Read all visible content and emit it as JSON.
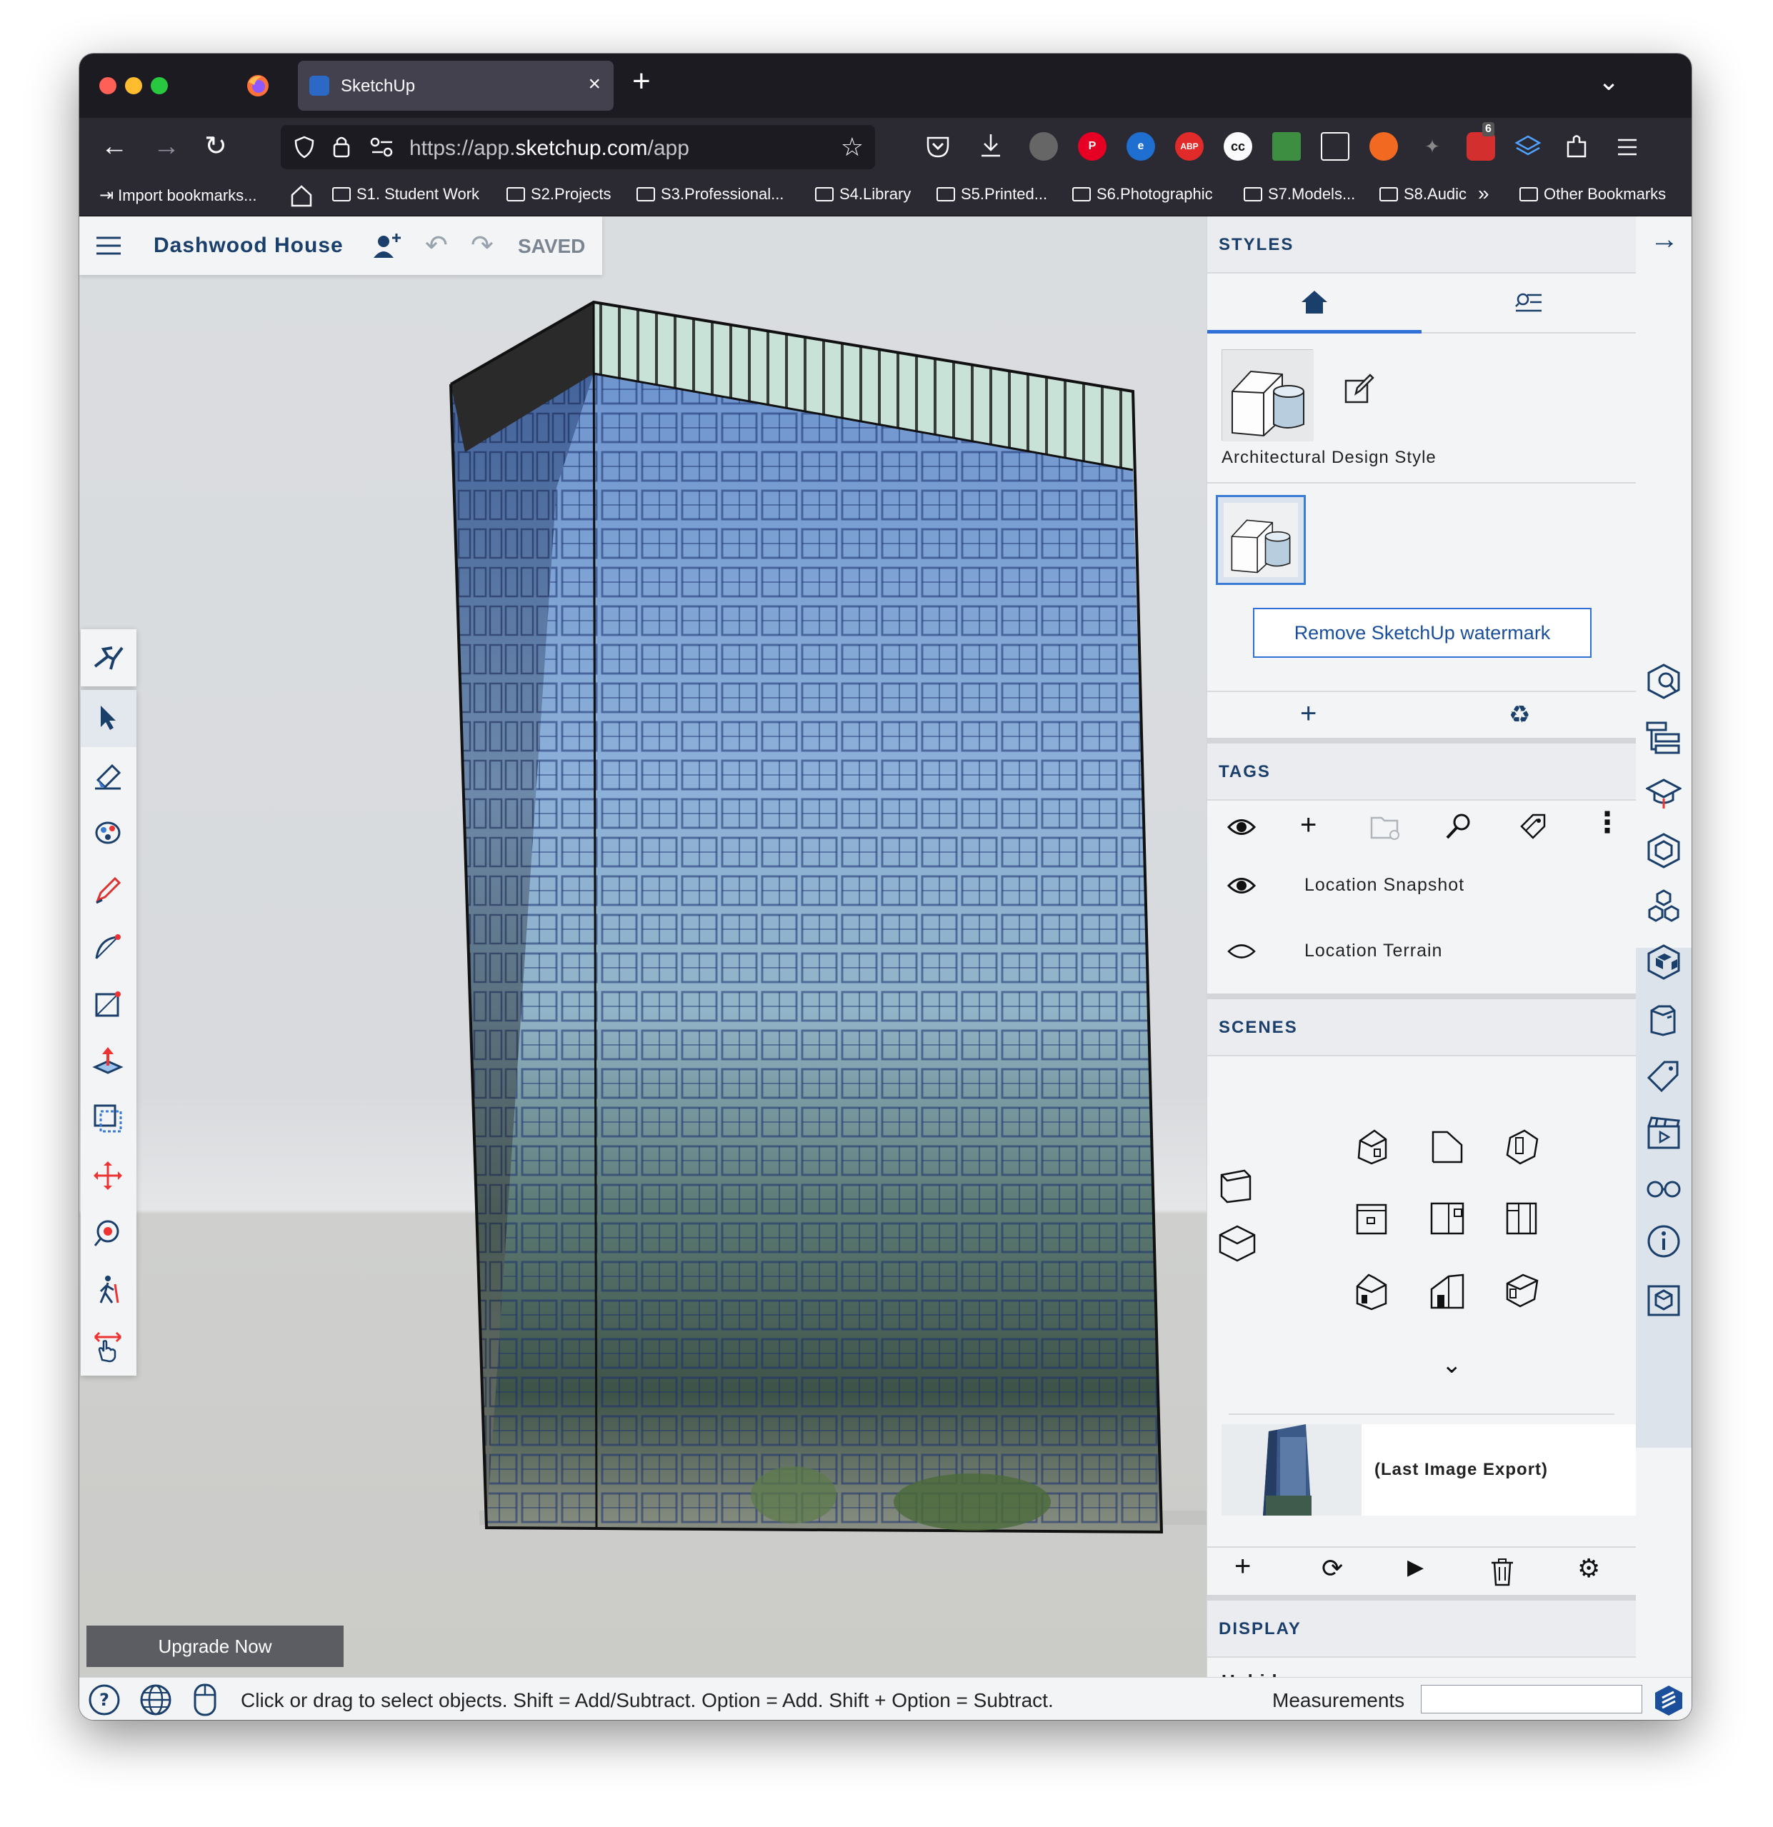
{
  "browser": {
    "tab_title": "SketchUp",
    "tab_close": "×",
    "new_tab": "+",
    "tab_list": "⌄",
    "url_prefix": "https://app.",
    "url_domain": "sketchup.com",
    "url_path": "/app",
    "ext_abp": "ABP",
    "ext_cc": "cc",
    "ext_badge": "6",
    "bookmarks": [
      "Import bookmarks...",
      "S1. Student Work",
      "S2.Projects",
      "S3.Professional...",
      "S4.Library",
      "S5.Printed...",
      "S6.Photographic",
      "S7.Models...",
      "S8.Audic",
      "Other Bookmarks"
    ]
  },
  "app": {
    "model_title": "Dashwood House",
    "save_status": "SAVED",
    "upgrade_label": "Upgrade Now"
  },
  "styles": {
    "header": "STYLES",
    "style_name": "Architectural Design Style",
    "watermark_button": "Remove SketchUp watermark"
  },
  "tags": {
    "header": "TAGS",
    "items": [
      {
        "name": "Location Snapshot"
      },
      {
        "name": "Location Terrain"
      }
    ]
  },
  "scenes": {
    "header": "SCENES",
    "scene_name": "(Last Image Export)"
  },
  "display": {
    "header": "DISPLAY",
    "unhide": "Unhide"
  },
  "status": {
    "hint": "Click or drag to select objects. Shift = Add/Subtract. Option = Add. Shift + Option = Subtract.",
    "measurements_label": "Measurements",
    "measurements_value": ""
  },
  "colors": {
    "accent": "#1b3f6b",
    "selection": "#3a7bd5",
    "titlebar": "#1c1b22",
    "toolbar": "#2b2a33"
  }
}
